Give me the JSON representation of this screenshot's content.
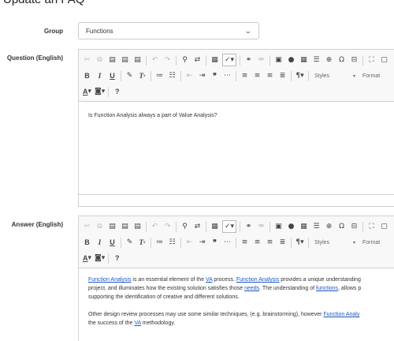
{
  "page": {
    "heading": "Update an FAQ"
  },
  "group": {
    "label": "Group",
    "selected": "Functions"
  },
  "question": {
    "label": "Question (English)",
    "text": "Is Function Analysis always a part of Value Analysis?"
  },
  "answer": {
    "label": "Answer (English)",
    "p1": {
      "link1": "Function Analysis",
      "t1": " is an essential element of the ",
      "link2": "VA",
      "t2": " process. ",
      "link3": "Function Analysis",
      "t3": " provides a unique understanding"
    },
    "p1_line2": {
      "t1": "project, and illuminates how the existing solution satisfies those ",
      "link1": "needs",
      "t2": ". The understanding of ",
      "link2": "functions",
      "t3": ", allows p"
    },
    "p1_line3": "supporting the identification of creative and different solutions.",
    "p2": {
      "t1": "Other design review processes may use some similar techniques,  (e.g. brainstorming), however ",
      "link1": "Function Analy"
    },
    "p2_line2": {
      "t1": "the success of the ",
      "link1": "VA",
      "t2": " methodology."
    }
  },
  "toolbar": {
    "styles_label": "Styles",
    "format_label": "Format",
    "help_label": "?"
  },
  "icons": {
    "cut": "scissors-icon",
    "copy": "copy-icon",
    "paste": "paste-icon",
    "undo": "undo-icon",
    "redo": "redo-icon",
    "find": "find-icon",
    "link": "link-icon",
    "image": "image-icon",
    "table": "table-icon"
  },
  "colors": {
    "link": "#1a56c4",
    "toolbar_bg": "#f8f8f8",
    "border": "#d1d1d1"
  }
}
